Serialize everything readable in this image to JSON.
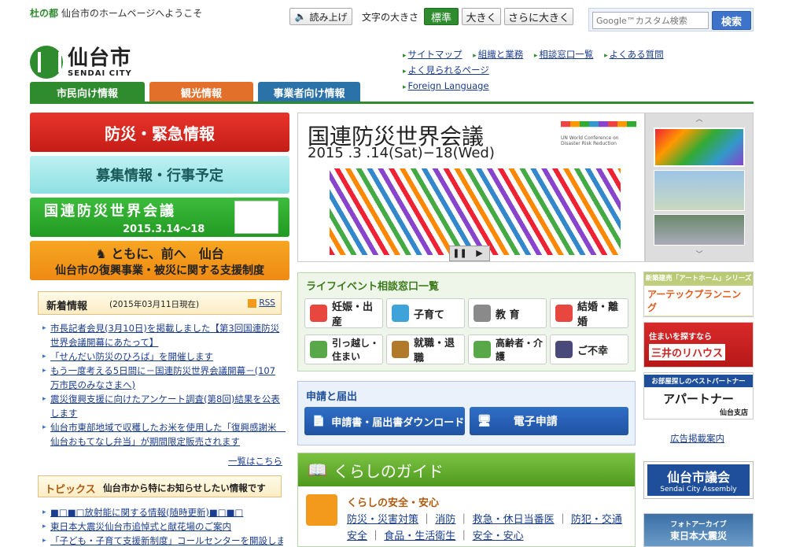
{
  "header": {
    "tagline_prefix": "杜の都",
    "tagline_text": "仙台市のホームページへようこそ",
    "readaloud_label": "読み上げ",
    "fontsize_label": "文字の大きさ",
    "fontsize_options": [
      "標準",
      "大きく",
      "さらに大きく"
    ],
    "search_placeholder": "Google™カスタム検索",
    "search_button": "検索"
  },
  "logo": {
    "jp": "仙台市",
    "en": "SENDAI CITY"
  },
  "utility_links": [
    "サイトマップ",
    "組織と業務",
    "相談窓口一覧",
    "よくある質問",
    "よく見られるページ",
    "Foreign Language"
  ],
  "tabs": [
    "市民向け情報",
    "観光情報",
    "事業者向け情報"
  ],
  "left_buttons": {
    "disaster": "防災・緊急情報",
    "recruit": "募集情報・行事予定",
    "conference_title": "国連防災世界会議",
    "conference_dates": "2015.3.14〜18",
    "recovery_line1": "ともに、前へ　仙台",
    "recovery_line2": "仙台市の復興事業・被災に関する支援制度"
  },
  "news": {
    "title": "新着情報",
    "date": "(2015年03月11日現在)",
    "rss": "RSS",
    "items": [
      "市長記者会見(3月10日)を掲載しました【第3回国連防災世界会議開幕にあたって】",
      "「せんだい防災のひろば」を開催します",
      "もう一度考える5日間に－国連防災世界会議開幕－(107万市民のみなさまへ)",
      "震災復興支援に向けたアンケート調査(第8回)結果を公表します",
      "仙台市東部地域で収穫したお米を使用した「復興感謝米　仙台おもてなし弁当」が期間限定販売されます"
    ],
    "more": "一覧はこちら"
  },
  "topics": {
    "title": "トピックス",
    "subtitle": "仙台市から特にお知らせしたい情報です",
    "items": [
      "■□■□放射能に関する情報(随時更新)■□■□",
      "東日本大震災仙台市追悼式と献花場のご案内",
      "「子ども・子育て支援新制度」コールセンターを開設しまし"
    ]
  },
  "banner": {
    "title": "国連防災世界会議",
    "date": "2015 .3 .14(Sat)−18(Wed)",
    "logo_caption": "UN World Conference on Disaster Risk Reduction"
  },
  "life_events": {
    "title": "ライフイベント相談窓口一覧",
    "items": [
      {
        "label": "妊娠・出産",
        "color": "#e8473f"
      },
      {
        "label": "子育て",
        "color": "#3da3d8"
      },
      {
        "label": "教 育",
        "color": "#8a8a8a"
      },
      {
        "label": "結婚・離婚",
        "color": "#e8473f"
      },
      {
        "label": "引っ越し・住まい",
        "color": "#58a84a"
      },
      {
        "label": "就職・退職",
        "color": "#b07a2a"
      },
      {
        "label": "高齢者・介護",
        "color": "#58a84a"
      },
      {
        "label": "ご不幸",
        "color": "#4a4a7a"
      }
    ]
  },
  "apply": {
    "title": "申請と届出",
    "download": "申請書・届出書ダウンロード",
    "online": "電子申請"
  },
  "guide": {
    "title": "くらしのガイド",
    "section": "くらしの安全・安心",
    "links": [
      "防災・災害対策",
      "消防",
      "救急・休日当番医",
      "防犯・交通安全",
      "食品・生活衛生",
      "安全・安心"
    ]
  },
  "ads": {
    "ad1_top": "新築建売「アートホーム」シリーズ",
    "ad1_name": "アーテックプランニング",
    "ad2_text": "住まいを探すなら",
    "ad2_name": "三井のリハウス",
    "ad3_top": "お部屋探しのベストパートナー",
    "ad3_name": "アパートナー",
    "ad3_sub": "仙台支店",
    "ad_link": "広告掲載案内",
    "assembly_jp": "仙台市議会",
    "assembly_en": "Sendai City Assembly",
    "archive_line1": "フォトアーカイブ",
    "archive_line2": "東日本大震災"
  }
}
